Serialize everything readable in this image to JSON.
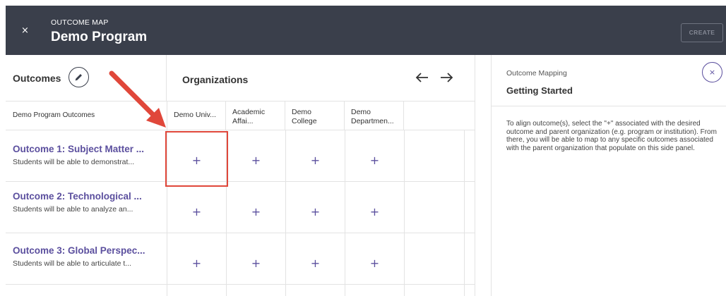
{
  "header": {
    "close_glyph": "×",
    "subtitle": "OUTCOME MAP",
    "title": "Demo Program",
    "create_label": "CREATE"
  },
  "outcomes_panel": {
    "title": "Outcomes",
    "edit_icon": "pencil-icon",
    "column_header": "Demo Program Outcomes"
  },
  "organizations_panel": {
    "title": "Organizations",
    "prev_icon": "arrow-left-icon",
    "next_icon": "arrow-right-icon",
    "columns": [
      {
        "line1": "Demo Univ...",
        "line2": ""
      },
      {
        "line1": "Academic",
        "line2": "Affai..."
      },
      {
        "line1": "Demo",
        "line2": "College"
      },
      {
        "line1": "Demo",
        "line2": "Departmen..."
      }
    ]
  },
  "rows": [
    {
      "title": "Outcome 1: Subject Matter ...",
      "desc": "Students will be able to demonstrat...",
      "cells": [
        "+",
        "+",
        "+",
        "+"
      ]
    },
    {
      "title": "Outcome 2: Technological ...",
      "desc": "Students will be able to analyze an...",
      "cells": [
        "+",
        "+",
        "+",
        "+"
      ]
    },
    {
      "title": "Outcome 3: Global Perspec...",
      "desc": "Students will be able to articulate t...",
      "cells": [
        "+",
        "+",
        "+",
        "+"
      ]
    }
  ],
  "side_panel": {
    "subtitle": "Outcome Mapping",
    "title": "Getting Started",
    "close_glyph": "×",
    "body": "To align outcome(s), select the \"+\" associated with the desired outcome and parent organization (e.g. program or institution). From there, you will be able to map to any specific outcomes associated with the parent organization that populate on this side panel."
  },
  "colors": {
    "header_bg": "#3a3f4b",
    "accent_purple": "#5b4f9e",
    "annotation_red": "#e0473a",
    "divider": "#e3e3e3"
  }
}
